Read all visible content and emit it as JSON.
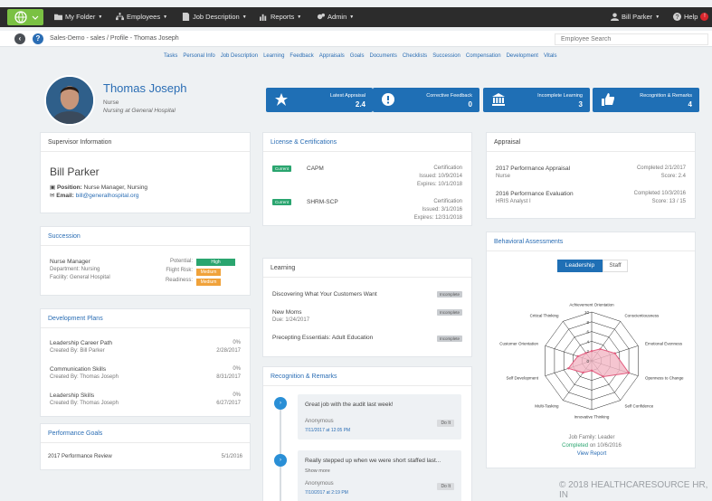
{
  "topbar": {
    "my_folder": "My Folder",
    "employees": "Employees",
    "job_description": "Job Description",
    "reports": "Reports",
    "admin": "Admin",
    "user": "Bill Parker",
    "help": "Help"
  },
  "crumbbar": {
    "crumbs": "Sales-Demo - sales  /  Profile - Thomas Joseph",
    "search_placeholder": "Employee Search"
  },
  "tabs": [
    "Tasks",
    "Personal Info",
    "Job Description",
    "Learning",
    "Feedback",
    "Appraisals",
    "Goals",
    "Documents",
    "Checklists",
    "Succession",
    "Compensation",
    "Development",
    "Vitals"
  ],
  "profile": {
    "name": "Thomas Joseph",
    "role": "Nurse",
    "org": "Nursing at General Hospital"
  },
  "stats": [
    {
      "label": "Latest Appraisal",
      "value": "2.4",
      "icon": "star-icon"
    },
    {
      "label": "Corrective Feedback",
      "value": "0",
      "icon": "alert-icon"
    },
    {
      "label": "Incomplete Learning",
      "value": "3",
      "icon": "bank-icon"
    },
    {
      "label": "Recognition & Remarks",
      "value": "4",
      "icon": "thumbs-up-icon"
    }
  ],
  "supervisor": {
    "title": "Supervisor Information",
    "name": "Bill Parker",
    "position_label": "Position:",
    "position": "Nurse Manager, Nursing",
    "email_label": "Email:",
    "email": "bill@generalhospital.org"
  },
  "succession": {
    "title": "Succession",
    "role": "Nurse Manager",
    "department": "Department: Nursing",
    "facility": "Facility: General Hospital",
    "potential_label": "Potential:",
    "potential": "High",
    "flight_label": "Flight Risk:",
    "flight": "Medium",
    "readiness_label": "Readiness:",
    "readiness": "Medium",
    "colors": {
      "high": "#2aa56f",
      "medium": "#f0a23a"
    }
  },
  "development": {
    "title": "Development Plans",
    "items": [
      {
        "name": "Leadership Career Path",
        "by": "Created By: Bill Parker",
        "pct": "0%",
        "date": "2/28/2017"
      },
      {
        "name": "Communication Skills",
        "by": "Created By: Thomas Joseph",
        "pct": "0%",
        "date": "8/31/2017"
      },
      {
        "name": "Leadership Skills",
        "by": "Created By: Thomas Joseph",
        "pct": "0%",
        "date": "6/27/2017"
      }
    ]
  },
  "goals": {
    "title": "Performance Goals",
    "item": "2017 Performance Review",
    "date": "5/1/2016"
  },
  "license": {
    "title": "License & Certifications",
    "items": [
      {
        "badge": "Current",
        "name": "CAPM",
        "type": "Certification",
        "issued": "Issued: 10/9/2014",
        "expires": "Expires: 10/1/2018"
      },
      {
        "badge": "Current",
        "name": "SHRM-SCP",
        "type": "Certification",
        "issued": "Issued: 3/1/2016",
        "expires": "Expires: 12/31/2018"
      }
    ]
  },
  "learning": {
    "title": "Learning",
    "items": [
      {
        "name": "Discovering What Your Customers Want",
        "due": "",
        "status": "Incomplete"
      },
      {
        "name": "New Moms",
        "due": "Due: 1/24/2017",
        "status": "Incomplete"
      },
      {
        "name": "Precepting Essentials: Adult Education",
        "due": "",
        "status": "Incomplete"
      }
    ]
  },
  "recognition": {
    "title": "Recognition & Remarks",
    "items": [
      {
        "text": "Great job with the audit last week!",
        "more": "",
        "author": "Anonymous",
        "date": "7/11/2017 at 12:05 PM",
        "btn": "Do It"
      },
      {
        "text": "Really stepped up when we were short staffed last...",
        "more": "Show more",
        "author": "Anonymous",
        "date": "7/10/2017 at 2:19 PM",
        "btn": "Do It"
      }
    ]
  },
  "appraisal": {
    "title": "Appraisal",
    "items": [
      {
        "name": "2017 Performance Appraisal",
        "sub": "Nurse",
        "status": "Completed 2/1/2017",
        "score": "Score: 2.4"
      },
      {
        "name": "2016 Performance Evaluation",
        "sub": "HRIS Analyst I",
        "status": "Completed 10/3/2016",
        "score": "Score: 13 / 15"
      }
    ]
  },
  "behavioral": {
    "title": "Behavioral Assessments",
    "toggle": [
      "Leadership",
      "Staff"
    ],
    "family": "Job Family: Leader",
    "completed_word": "Completed",
    "completed_date": "on 10/6/2016",
    "view": "View Report"
  },
  "chart_data": {
    "type": "radar",
    "categories": [
      "Achievement Orientation",
      "Conscientiousness",
      "Emotional Evenness",
      "Openness to Change",
      "Self Confidence",
      "Innovative Thinking",
      "Multi-Tasking",
      "Self Development",
      "Customer Orientation",
      "Critical Thinking"
    ],
    "values": [
      2,
      3,
      5,
      8,
      4,
      2,
      3,
      5,
      3,
      2
    ],
    "ticks": [
      "0",
      "2",
      "4",
      "6",
      "8",
      "10"
    ],
    "rmax": 10,
    "fill": "#f2b6c4",
    "stroke": "#e25b7e"
  },
  "footer": "© 2018 HEALTHCARESOURCE HR, IN"
}
